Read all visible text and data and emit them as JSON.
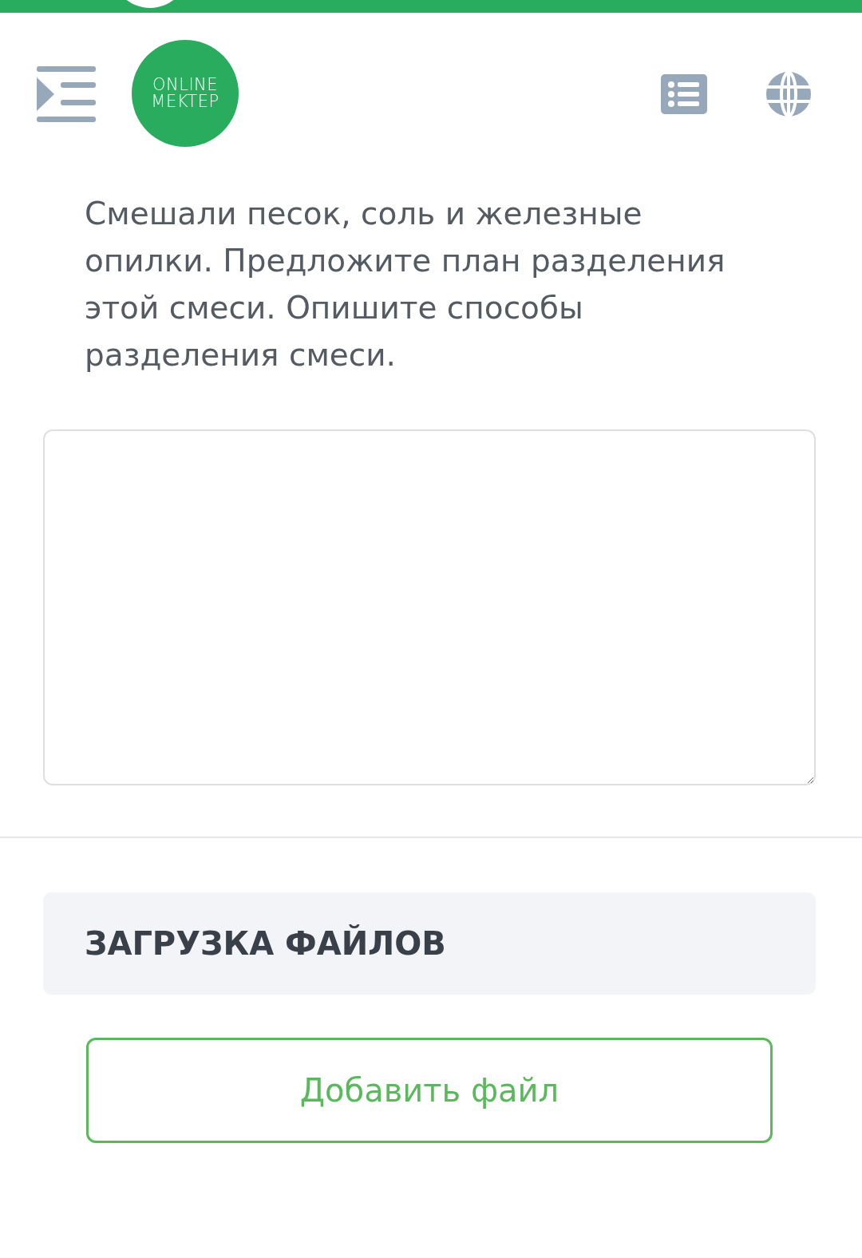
{
  "header": {
    "logo_lines": [
      "ONLINE",
      "MEKTEP"
    ]
  },
  "question": "Смешали песок, соль и железные опилки. Предложите план разделения этой смеси. Опишите способы разделения смеси.",
  "upload": {
    "title": "ЗАГРУЗКА ФАЙЛОВ",
    "button": "Добавить файл"
  }
}
